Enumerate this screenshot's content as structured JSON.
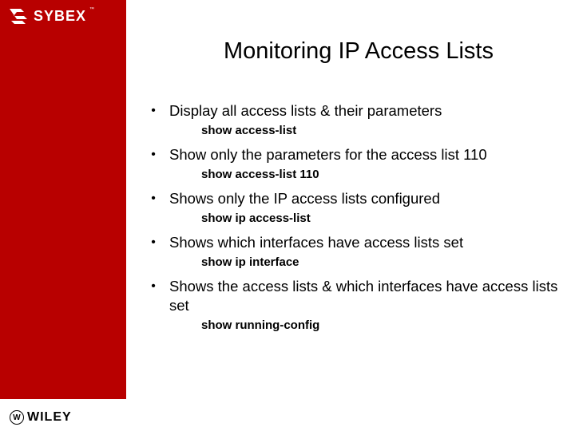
{
  "logo": {
    "sybex": "SYBEX",
    "sybex_tm": "™",
    "wiley": "WILEY",
    "wiley_mark": "W"
  },
  "title": "Monitoring IP Access Lists",
  "bullets": [
    {
      "text": "Display all access lists & their parameters",
      "command": "show access-list"
    },
    {
      "text": "Show only the parameters for the access list 110",
      "command": "show access-list 110"
    },
    {
      "text": "Shows only the IP access lists configured",
      "command": "show ip access-list"
    },
    {
      "text": "Shows which interfaces have access lists set",
      "command": "show ip interface"
    },
    {
      "text": "Shows the access lists & which interfaces have access lists set",
      "command": "show running-config"
    }
  ]
}
